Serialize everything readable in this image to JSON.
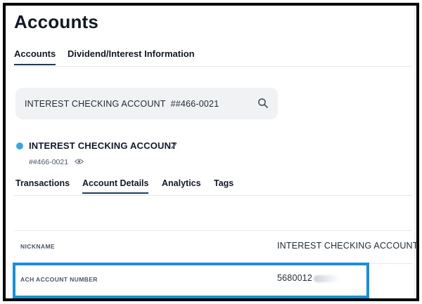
{
  "page": {
    "title": "Accounts"
  },
  "top_tabs": [
    {
      "label": "Accounts",
      "active": true
    },
    {
      "label": "Dividend/Interest Information",
      "active": false
    }
  ],
  "account_selector": {
    "name": "INTEREST CHECKING ACCOUNT",
    "masked_number": "##466-0021",
    "icon": "search-icon"
  },
  "account_header": {
    "name": "INTEREST CHECKING ACCOUNT",
    "masked_number": "##466-0021",
    "status_color": "#3ea6de",
    "edit_icon": "pencil-icon",
    "visibility_icon": "eye-icon"
  },
  "sub_tabs": [
    {
      "label": "Transactions",
      "active": false
    },
    {
      "label": "Account Details",
      "active": true
    },
    {
      "label": "Analytics",
      "active": false
    },
    {
      "label": "Tags",
      "active": false
    }
  ],
  "details": [
    {
      "label": "NICKNAME",
      "value": "INTEREST CHECKING ACCOUNT"
    },
    {
      "label": "ACH ACCOUNT NUMBER",
      "value": "5680012"
    }
  ],
  "colors": {
    "accent_tab_underline": "#1e3a5f",
    "highlight_border": "#1a8fd6"
  }
}
